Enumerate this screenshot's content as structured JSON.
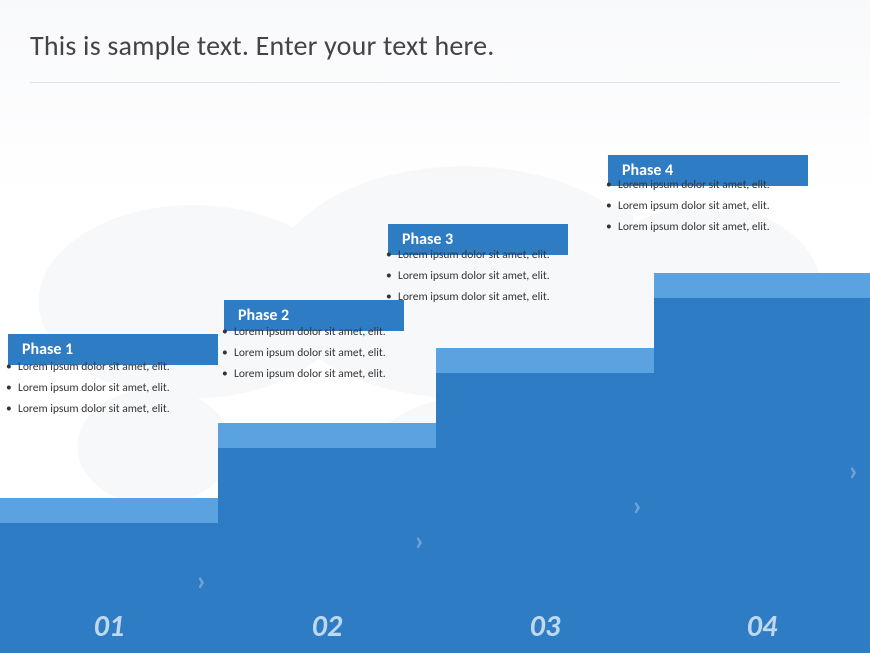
{
  "slide": {
    "title": "This is sample text. Enter your text here.",
    "phases": [
      {
        "id": 1,
        "label": "Phase 1",
        "number": "01",
        "bullets": [
          "Lorem ipsum dolor sit amet, elit.",
          "Lorem ipsum dolor sit amet, elit.",
          "Lorem ipsum dolor sit amet, elit."
        ]
      },
      {
        "id": 2,
        "label": "Phase 2",
        "number": "02",
        "bullets": [
          "Lorem ipsum dolor sit amet, elit.",
          "Lorem ipsum dolor sit amet, elit.",
          "Lorem ipsum dolor sit amet, elit."
        ]
      },
      {
        "id": 3,
        "label": "Phase 3",
        "number": "03",
        "bullets": [
          "Lorem ipsum dolor sit amet, elit.",
          "Lorem ipsum dolor sit amet, elit.",
          "Lorem ipsum dolor sit amet, elit."
        ]
      },
      {
        "id": 4,
        "label": "Phase 4",
        "number": "04",
        "bullets": [
          "Lorem ipsum dolor sit amet, elit.",
          "Lorem ipsum dolor sit amet, elit.",
          "Lorem ipsum dolor sit amet, elit."
        ]
      }
    ]
  }
}
